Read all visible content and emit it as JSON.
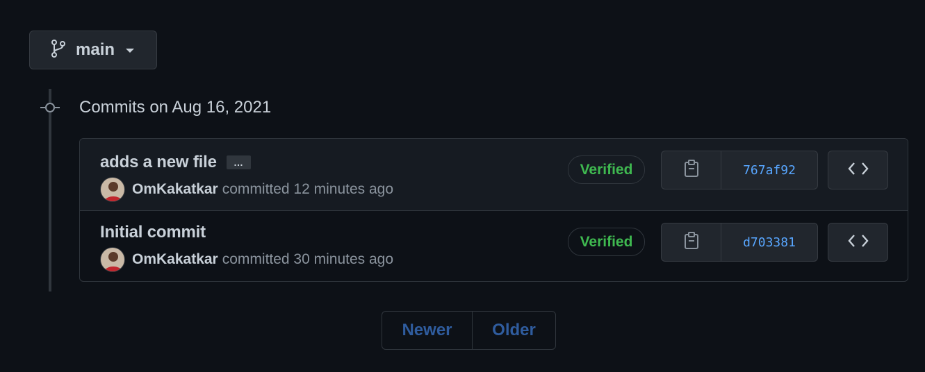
{
  "branch": {
    "name": "main"
  },
  "group": {
    "heading": "Commits on Aug 16, 2021"
  },
  "commits": [
    {
      "title": "adds a new file",
      "author": "OmKakatkar",
      "time_text": "committed 12 minutes ago",
      "badge": "Verified",
      "sha": "767af92",
      "has_more": true,
      "more_label": "…"
    },
    {
      "title": "Initial commit",
      "author": "OmKakatkar",
      "time_text": "committed 30 minutes ago",
      "badge": "Verified",
      "sha": "d703381",
      "has_more": false
    }
  ],
  "pagination": {
    "newer": "Newer",
    "older": "Older"
  },
  "icons": {
    "branch": "git-branch-icon",
    "caret": "caret-down-icon",
    "commit": "git-commit-icon",
    "copy": "clipboard-icon",
    "browse": "code-icon"
  },
  "colors": {
    "background": "#0d1117",
    "verified": "#3fb950",
    "sha_link": "#58a6ff",
    "pagination_disabled": "#2f5c9e"
  }
}
